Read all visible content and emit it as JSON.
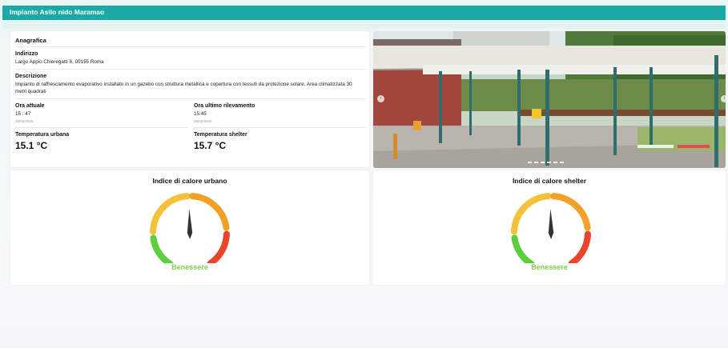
{
  "header": {
    "title": "Impianto Asilo nido Maramao"
  },
  "info": {
    "section_title": "Anagrafica",
    "address_label": "Indirizzo",
    "address_value": "Largo Appio Chieregatti 8, 00155 Roma",
    "description_label": "Descrizione",
    "description_value": "Impianto di raffrescamento evaporativo installato in un gazebo con struttura metallica e copertura con tessuti da protezione solare. Area climatizzata 30 metri quadrati",
    "current_time_label": "Ora attuale",
    "current_time_value": "15 : 47",
    "current_date": "26/02/2025",
    "last_reading_label": "Ora ultimo rilevamento",
    "last_reading_value": "15:45",
    "last_reading_date": "26/02/2025",
    "urban_temp_label": "Temperatura urbana",
    "urban_temp_value": "15.1 °C",
    "shelter_temp_label": "Temperatura shelter",
    "shelter_temp_value": "15.7 °C"
  },
  "gauges": [
    {
      "title": "Indice di calore urbano",
      "status": "Benessere",
      "level": 0.62
    },
    {
      "title": "Indice di calore shelter",
      "status": "Benessere",
      "level": 0.62
    }
  ],
  "colors": {
    "header": "#1aa9a5",
    "green": "#5bcf3c",
    "yellow": "#f3c13a",
    "orange": "#f0a126",
    "red": "#e8452c",
    "status": "#7ad04a"
  },
  "carousel": {
    "prev_icon": "chevron-left-icon",
    "next_icon": "chevron-right-icon"
  }
}
